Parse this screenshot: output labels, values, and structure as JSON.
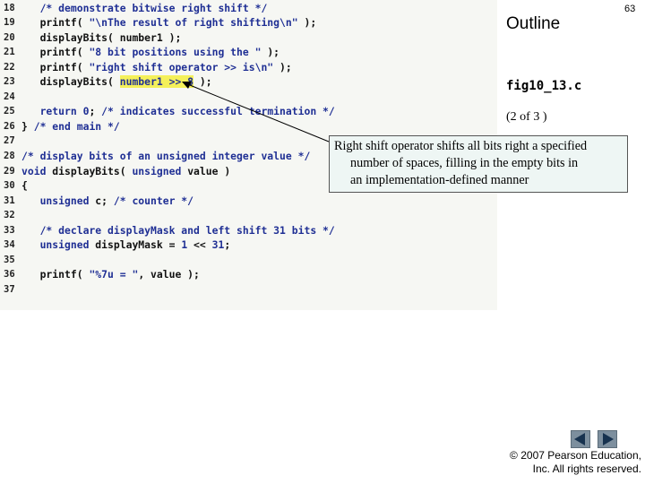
{
  "slide": {
    "page_number": "63",
    "outline_label": "Outline",
    "figure_name": "fig10_13.c",
    "page_of": "(2 of 3 )"
  },
  "callout": {
    "line1": "Right shift operator shifts all bits right a specified",
    "line2": "number of spaces, filling in the empty bits in",
    "line3": "an implementation-defined manner"
  },
  "code": {
    "lines": [
      {
        "n": "18",
        "tokens": [
          {
            "t": "   /* demonstrate bitwise right shift */",
            "c": "c"
          }
        ]
      },
      {
        "n": "19",
        "tokens": [
          {
            "t": "   printf( ",
            "c": "p"
          },
          {
            "t": "\"\\nThe result of right shifting\\n\"",
            "c": "s"
          },
          {
            "t": " );",
            "c": "p"
          }
        ]
      },
      {
        "n": "20",
        "tokens": [
          {
            "t": "   displayBits( number1 );",
            "c": "p"
          }
        ]
      },
      {
        "n": "21",
        "tokens": [
          {
            "t": "   printf( ",
            "c": "p"
          },
          {
            "t": "\"8 bit positions using the \"",
            "c": "s"
          },
          {
            "t": " );",
            "c": "p"
          }
        ]
      },
      {
        "n": "22",
        "tokens": [
          {
            "t": "   printf( ",
            "c": "p"
          },
          {
            "t": "\"right shift operator >> is\\n\"",
            "c": "s"
          },
          {
            "t": " );",
            "c": "p"
          }
        ]
      },
      {
        "n": "23",
        "tokens": [
          {
            "t": "   displayBits( ",
            "c": "p"
          },
          {
            "t": "number1 >> 8",
            "c": "h"
          },
          {
            "t": " );",
            "c": "p"
          }
        ]
      },
      {
        "n": "24",
        "tokens": [
          {
            "t": "",
            "c": "p"
          }
        ]
      },
      {
        "n": "25",
        "tokens": [
          {
            "t": "   return ",
            "c": "k"
          },
          {
            "t": "0",
            "c": "n"
          },
          {
            "t": "; ",
            "c": "p"
          },
          {
            "t": "/* indicates successful termination */",
            "c": "c"
          }
        ]
      },
      {
        "n": "26",
        "tokens": [
          {
            "t": "} ",
            "c": "p"
          },
          {
            "t": "/* end main */",
            "c": "c"
          }
        ]
      },
      {
        "n": "27",
        "tokens": [
          {
            "t": "",
            "c": "p"
          }
        ]
      },
      {
        "n": "28",
        "tokens": [
          {
            "t": "/* display bits of an unsigned integer value */",
            "c": "c"
          }
        ]
      },
      {
        "n": "29",
        "tokens": [
          {
            "t": "void ",
            "c": "k"
          },
          {
            "t": "displayBits( ",
            "c": "p"
          },
          {
            "t": "unsigned ",
            "c": "k"
          },
          {
            "t": "value )",
            "c": "p"
          }
        ]
      },
      {
        "n": "30",
        "tokens": [
          {
            "t": "{",
            "c": "p"
          }
        ]
      },
      {
        "n": "31",
        "tokens": [
          {
            "t": "   unsigned ",
            "c": "k"
          },
          {
            "t": "c; ",
            "c": "p"
          },
          {
            "t": "/* counter */",
            "c": "c"
          }
        ]
      },
      {
        "n": "32",
        "tokens": [
          {
            "t": "",
            "c": "p"
          }
        ]
      },
      {
        "n": "33",
        "tokens": [
          {
            "t": "   /* declare displayMask and left shift 31 bits */",
            "c": "c"
          }
        ]
      },
      {
        "n": "34",
        "tokens": [
          {
            "t": "   unsigned ",
            "c": "k"
          },
          {
            "t": "displayMask = ",
            "c": "p"
          },
          {
            "t": "1",
            "c": "n"
          },
          {
            "t": " << ",
            "c": "p"
          },
          {
            "t": "31",
            "c": "n"
          },
          {
            "t": ";",
            "c": "p"
          }
        ]
      },
      {
        "n": "35",
        "tokens": [
          {
            "t": "",
            "c": "p"
          }
        ]
      },
      {
        "n": "36",
        "tokens": [
          {
            "t": "   printf( ",
            "c": "p"
          },
          {
            "t": "\"%7u = \"",
            "c": "s"
          },
          {
            "t": ", value );",
            "c": "p"
          }
        ]
      },
      {
        "n": "37",
        "tokens": [
          {
            "t": "",
            "c": "p"
          }
        ]
      }
    ]
  },
  "navigation": {
    "prev_icon": "triangle-left-icon",
    "next_icon": "triangle-right-icon"
  },
  "copyright": {
    "line1": "© 2007 Pearson Education,",
    "line2": "Inc. All rights reserved."
  },
  "colors": {
    "code_blue": "#1f2f94",
    "highlight": "#f4f05a",
    "callout_bg": "#eef6f4",
    "nav_button": "#7d8f9e"
  }
}
